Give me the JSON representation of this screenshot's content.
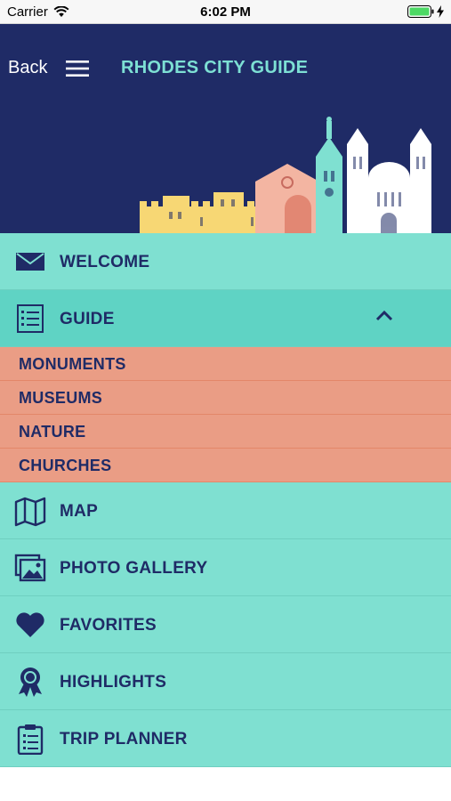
{
  "status_bar": {
    "carrier": "Carrier",
    "time": "6:02 PM",
    "battery_level_percent": 100,
    "battery_color": "#4cd964"
  },
  "nav": {
    "back_label": "Back",
    "title": "RHODES CITY GUIDE",
    "menu_icon": "hamburger-icon"
  },
  "colors": {
    "navy": "#1f2b66",
    "teal": "#7fe0d1",
    "teal_active": "#5fd3c4",
    "salmon": "#ea9d85",
    "title_teal": "#7de0d4"
  },
  "menu": {
    "welcome": {
      "label": "WELCOME",
      "icon": "envelope-icon"
    },
    "guide": {
      "label": "GUIDE",
      "icon": "list-icon",
      "expanded": true,
      "chevron": "chevron-up-icon",
      "subitems": [
        {
          "label": "MONUMENTS"
        },
        {
          "label": "MUSEUMS"
        },
        {
          "label": "NATURE"
        },
        {
          "label": "CHURCHES"
        }
      ]
    },
    "map": {
      "label": "MAP",
      "icon": "map-icon"
    },
    "photo_gallery": {
      "label": "PHOTO GALLERY",
      "icon": "photos-icon"
    },
    "favorites": {
      "label": "FAVORITES",
      "icon": "heart-icon"
    },
    "highlights": {
      "label": "HIGHLIGHTS",
      "icon": "ribbon-icon"
    },
    "trip_planner": {
      "label": "TRIP PLANNER",
      "icon": "clipboard-icon"
    }
  }
}
